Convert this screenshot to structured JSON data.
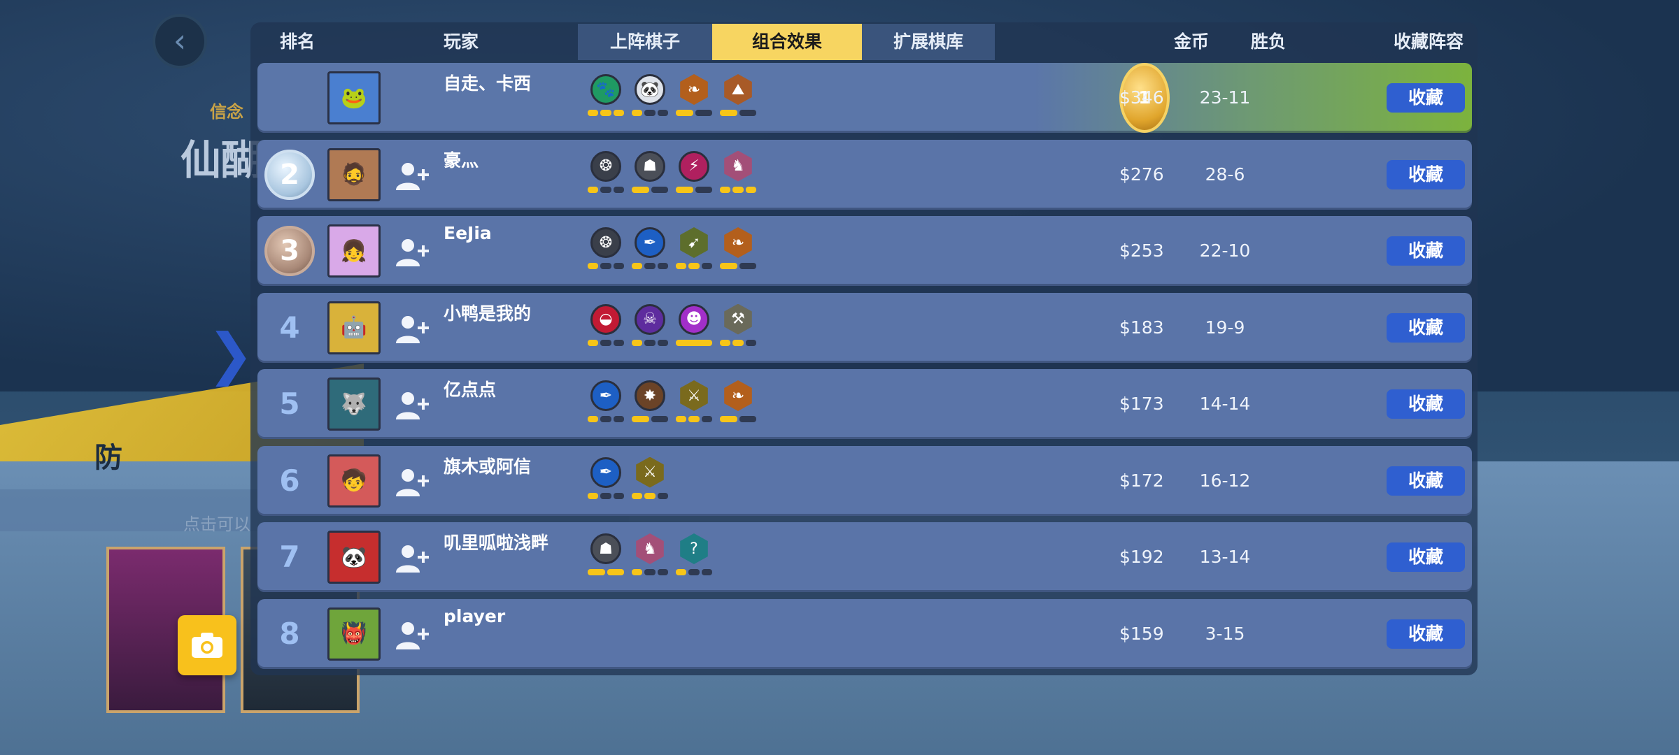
{
  "header": {
    "rank": "排名",
    "player": "玩家",
    "tabs": [
      {
        "label": "上阵棋子",
        "active": false
      },
      {
        "label": "组合效果",
        "active": true
      },
      {
        "label": "扩展棋库",
        "active": false
      }
    ],
    "gold": "金币",
    "wl": "胜负",
    "favorite": "收藏阵容"
  },
  "background": {
    "text1": "信念",
    "text2": "仙醐",
    "text3": "防",
    "text4": "点击可以"
  },
  "colors": {
    "tab_active": "#f7d561",
    "fav_button": "#2f5fd0",
    "pip_on": "#f7c518",
    "row": "#5a74a8"
  },
  "rows": [
    {
      "rank": "1",
      "badge": "gold",
      "name": "自走、卡西",
      "gold": "$346",
      "wl": "23-11",
      "fav": "收藏",
      "add_friend": false,
      "synergies": [
        {
          "icon": "paw-icon",
          "glyph": "🐾",
          "color": "#1f9a63",
          "shape": "circle",
          "pips": [
            1,
            1,
            1
          ]
        },
        {
          "icon": "panda-icon",
          "glyph": "🐼",
          "color": "#dfe3ea",
          "shape": "circle",
          "pips": [
            1,
            0,
            0
          ]
        },
        {
          "icon": "leaf-icon",
          "glyph": "❧",
          "color": "#b35f1c",
          "shape": "hex",
          "pips": [
            1,
            0
          ]
        },
        {
          "icon": "mountain-icon",
          "glyph": "⛰",
          "color": "#a85a27",
          "shape": "hex",
          "pips": [
            1,
            0
          ]
        }
      ]
    },
    {
      "rank": "2",
      "badge": "silver",
      "name": "豪灬",
      "gold": "$276",
      "wl": "28-6",
      "fav": "收藏",
      "add_friend": true,
      "synergies": [
        {
          "icon": "rune-icon",
          "glyph": "❂",
          "color": "#3a3f4a",
          "shape": "circle",
          "pips": [
            1,
            0,
            0
          ]
        },
        {
          "icon": "helmet-icon",
          "glyph": "☗",
          "color": "#4b4f58",
          "shape": "circle",
          "pips": [
            1,
            0
          ]
        },
        {
          "icon": "claw-icon",
          "glyph": "⚡",
          "color": "#b0205f",
          "shape": "circle",
          "pips": [
            1,
            0
          ]
        },
        {
          "icon": "knight-icon",
          "glyph": "♞",
          "color": "#a34f78",
          "shape": "hex",
          "pips": [
            1,
            1,
            1
          ]
        }
      ]
    },
    {
      "rank": "3",
      "badge": "bronze",
      "name": "EeJia",
      "gold": "$253",
      "wl": "22-10",
      "fav": "收藏",
      "add_friend": true,
      "synergies": [
        {
          "icon": "rune-icon",
          "glyph": "❂",
          "color": "#3a3f4a",
          "shape": "circle",
          "pips": [
            1,
            0,
            0
          ]
        },
        {
          "icon": "feather-icon",
          "glyph": "✒",
          "color": "#1d5fc4",
          "shape": "circle",
          "pips": [
            1,
            0,
            0
          ]
        },
        {
          "icon": "bow-icon",
          "glyph": "➹",
          "color": "#5d6e2c",
          "shape": "hex",
          "pips": [
            1,
            1,
            0
          ]
        },
        {
          "icon": "leaf-icon",
          "glyph": "❧",
          "color": "#b35f1c",
          "shape": "hex",
          "pips": [
            1,
            0
          ]
        }
      ]
    },
    {
      "rank": "4",
      "badge": "",
      "name": "小鸭是我的",
      "gold": "$183",
      "wl": "19-9",
      "fav": "收藏",
      "add_friend": true,
      "synergies": [
        {
          "icon": "demon-icon",
          "glyph": "◒",
          "color": "#c21a34",
          "shape": "circle",
          "pips": [
            1,
            0,
            0
          ]
        },
        {
          "icon": "skeleton-icon",
          "glyph": "☠",
          "color": "#5e2c9e",
          "shape": "circle",
          "pips": [
            1,
            0,
            0
          ]
        },
        {
          "icon": "ogre-icon",
          "glyph": "☻",
          "color": "#a22fc9",
          "shape": "circle",
          "pips": [
            1
          ]
        },
        {
          "icon": "axe-icon",
          "glyph": "⚒",
          "color": "#6a6a5a",
          "shape": "hex",
          "pips": [
            1,
            1,
            0
          ]
        }
      ]
    },
    {
      "rank": "5",
      "badge": "",
      "name": "亿点点",
      "gold": "$173",
      "wl": "14-14",
      "fav": "收藏",
      "add_friend": true,
      "synergies": [
        {
          "icon": "feather-icon",
          "glyph": "✒",
          "color": "#1d5fc4",
          "shape": "circle",
          "pips": [
            1,
            0,
            0
          ]
        },
        {
          "icon": "spider-icon",
          "glyph": "✸",
          "color": "#6b4327",
          "shape": "circle",
          "pips": [
            1,
            0
          ]
        },
        {
          "icon": "trident-icon",
          "glyph": "⚔",
          "color": "#7a6a1d",
          "shape": "hex",
          "pips": [
            1,
            1,
            0
          ]
        },
        {
          "icon": "leaf-icon",
          "glyph": "❧",
          "color": "#b35f1c",
          "shape": "hex",
          "pips": [
            1,
            0
          ]
        }
      ]
    },
    {
      "rank": "6",
      "badge": "",
      "name": "旗木或阿信",
      "gold": "$172",
      "wl": "16-12",
      "fav": "收藏",
      "add_friend": true,
      "synergies": [
        {
          "icon": "feather-icon",
          "glyph": "✒",
          "color": "#1d5fc4",
          "shape": "circle",
          "pips": [
            1,
            0,
            0
          ]
        },
        {
          "icon": "trident-icon",
          "glyph": "⚔",
          "color": "#7a6a1d",
          "shape": "hex",
          "pips": [
            1,
            1,
            0
          ]
        }
      ]
    },
    {
      "rank": "7",
      "badge": "",
      "name": "叽里呱啦浅畔",
      "gold": "$192",
      "wl": "13-14",
      "fav": "收藏",
      "add_friend": true,
      "synergies": [
        {
          "icon": "helmet-icon",
          "glyph": "☗",
          "color": "#4b4f58",
          "shape": "circle",
          "pips": [
            1,
            1
          ]
        },
        {
          "icon": "knight-icon",
          "glyph": "♞",
          "color": "#a34f78",
          "shape": "hex",
          "pips": [
            1,
            0,
            0
          ]
        },
        {
          "icon": "mystery-icon",
          "glyph": "?",
          "color": "#1f7e86",
          "shape": "hex",
          "pips": [
            1,
            0,
            0
          ]
        }
      ]
    },
    {
      "rank": "8",
      "badge": "",
      "name": "player",
      "gold": "$159",
      "wl": "3-15",
      "fav": "收藏",
      "add_friend": true,
      "synergies": []
    }
  ]
}
